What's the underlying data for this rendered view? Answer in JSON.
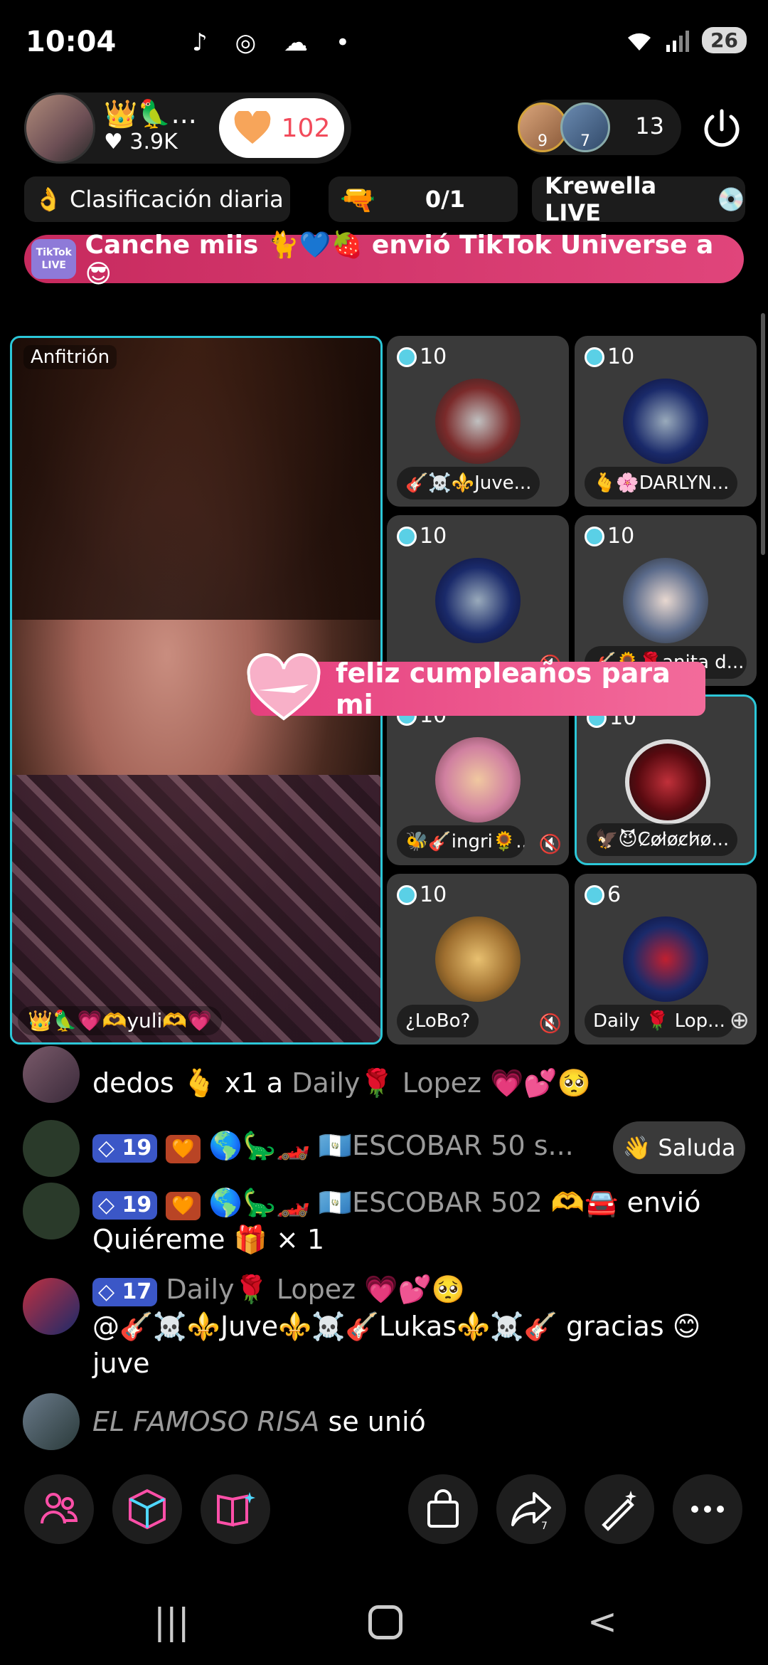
{
  "status_bar": {
    "time": "10:04",
    "battery": "26"
  },
  "host": {
    "name": "👑🦜...",
    "likes": "♥ 3.9K",
    "like_count": "102"
  },
  "viewers": {
    "avatar1_badge": "9",
    "avatar2_badge": "7",
    "count": "13"
  },
  "chips": {
    "ranking": "👌 Clasificación diaria",
    "goal": "0/1",
    "krewella": "Krewella LIVE"
  },
  "banner": {
    "badge": "TikTok LIVE",
    "text": "Canche miis 🐈💙🍓 envió TikTok Universe a 😎"
  },
  "host_video": {
    "tag": "Anfitrión",
    "name": "👑🦜💗🫶yuli🫶💗"
  },
  "guests": [
    {
      "score": "10",
      "name": "🎸☠️⚜️Juve..."
    },
    {
      "score": "10",
      "name": "🫰🌸DARLYN..."
    },
    {
      "score": "10",
      "name": ""
    },
    {
      "score": "10",
      "name": "🎸🌻🌹anita d..."
    },
    {
      "score": "10",
      "name": "🐝🎸ingri🌻..."
    },
    {
      "score": "10",
      "name": "🦅😈C̷o̷l̷o̷c̷h̷o̷..."
    },
    {
      "score": "10",
      "name": "¿LoBo?"
    },
    {
      "score": "6",
      "name": "Daily 🌹 Lop..."
    }
  ],
  "gift": {
    "text": "feliz cumpleaños para mi"
  },
  "chat": {
    "row0_text": "dedos 🫰 x1 a",
    "row0_target": "Daily🌹 Lopez 💗💕🥺",
    "row1_level": "19",
    "row1_user": "🌎🦕🏎️ 🇬🇹ESCOBAR 50 s...",
    "row2_level": "19",
    "row2_user": "🌎🦕🏎️ 🇬🇹ESCOBAR 502 🫶🚘",
    "row2_action": "envió Quiéreme 🎁 × 1",
    "row3_level": "17",
    "row3_user": "Daily🌹 Lopez 💗💕🥺",
    "row3_msg": "@🎸☠️⚜️Juve⚜️☠️🎸Lukas⚜️☠️🎸 gracias 😊 juve",
    "row4_user": "EL FAMOSO RISA",
    "row4_action": "se unió",
    "saluda": "Saluda"
  },
  "colors": {
    "accent": "#2cc7d8",
    "banner": "#d63a6e",
    "gift": "#ec5590",
    "level": "#3b57c7"
  }
}
